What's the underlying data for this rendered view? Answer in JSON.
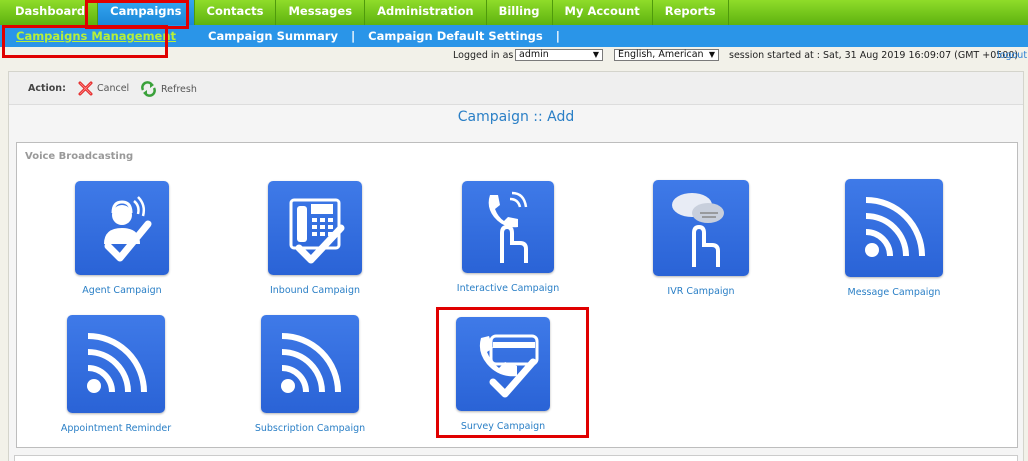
{
  "topnav": {
    "tabs": [
      {
        "label": "Dashboard"
      },
      {
        "label": "Campaigns"
      },
      {
        "label": "Contacts"
      },
      {
        "label": "Messages"
      },
      {
        "label": "Administration"
      },
      {
        "label": "Billing"
      },
      {
        "label": "My Account"
      },
      {
        "label": "Reports"
      }
    ],
    "active_index": 1
  },
  "subnav": {
    "items": [
      {
        "label": "Campaigns Management"
      },
      {
        "label": "Campaign Summary"
      },
      {
        "label": "Campaign Default Settings"
      }
    ],
    "separator": "|",
    "active_index": 0
  },
  "session": {
    "logged_in_label": "Logged in as :",
    "user_value": "admin",
    "language_value": "English, American",
    "session_text": "session started at : Sat, 31 Aug 2019 16:09:07 (GMT +0500)",
    "logout_label": "logout"
  },
  "actions": {
    "label": "Action:",
    "cancel_label": "Cancel",
    "refresh_label": "Refresh"
  },
  "page": {
    "title": "Campaign :: Add",
    "section_label": "Voice Broadcasting"
  },
  "campaign_types": [
    {
      "label": "Agent Campaign",
      "icon": "agent-headset-icon"
    },
    {
      "label": "Inbound Campaign",
      "icon": "desk-phone-icon"
    },
    {
      "label": "Interactive Campaign",
      "icon": "phone-touch-icon"
    },
    {
      "label": "IVR Campaign",
      "icon": "chat-touch-icon"
    },
    {
      "label": "Message Campaign",
      "icon": "broadcast-signal-icon"
    },
    {
      "label": "Appointment Reminder",
      "icon": "broadcast-signal-icon"
    },
    {
      "label": "Subscription Campaign",
      "icon": "broadcast-signal-icon"
    },
    {
      "label": "Survey Campaign",
      "icon": "survey-phone-icon"
    }
  ],
  "colors": {
    "nav_green": "#6cc41a",
    "nav_active_blue": "#2a95e8",
    "subnav_blue": "#2a95e8",
    "link_blue": "#2a7fc6",
    "icon_blue": "#3470e0",
    "highlight_red": "#e00000"
  }
}
